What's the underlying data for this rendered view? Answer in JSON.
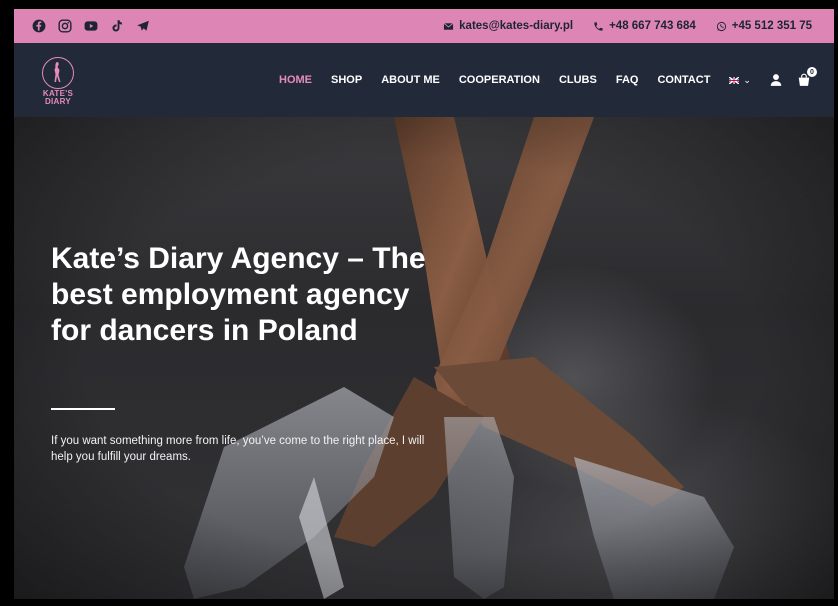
{
  "topbar": {
    "social": [
      {
        "icon": "facebook-icon"
      },
      {
        "icon": "instagram-icon"
      },
      {
        "icon": "youtube-icon"
      },
      {
        "icon": "tiktok-icon"
      },
      {
        "icon": "telegram-icon"
      }
    ],
    "email": "kates@kates-diary.pl",
    "phone": "+48 667 743 684",
    "whatsapp": "+45 512 351 75"
  },
  "nav": {
    "logo_line1": "KATE'S",
    "logo_line2": "DIARY",
    "items": [
      {
        "label": "HOME"
      },
      {
        "label": "SHOP"
      },
      {
        "label": "ABOUT ME"
      },
      {
        "label": "COOPERATION"
      },
      {
        "label": "CLUBS"
      },
      {
        "label": "FAQ"
      },
      {
        "label": "CONTACT"
      }
    ],
    "active": "HOME",
    "cart_count": "0"
  },
  "hero": {
    "title": "Kate’s Diary Agency – The best employment agency for dancers in Poland",
    "subtitle": "If you want something more from life, you’ve come to the right place, I will help you fulfill your dreams."
  },
  "colors": {
    "topbar_bg": "#dd86b5",
    "nav_bg": "#222a3a",
    "accent": "#e58cba"
  }
}
